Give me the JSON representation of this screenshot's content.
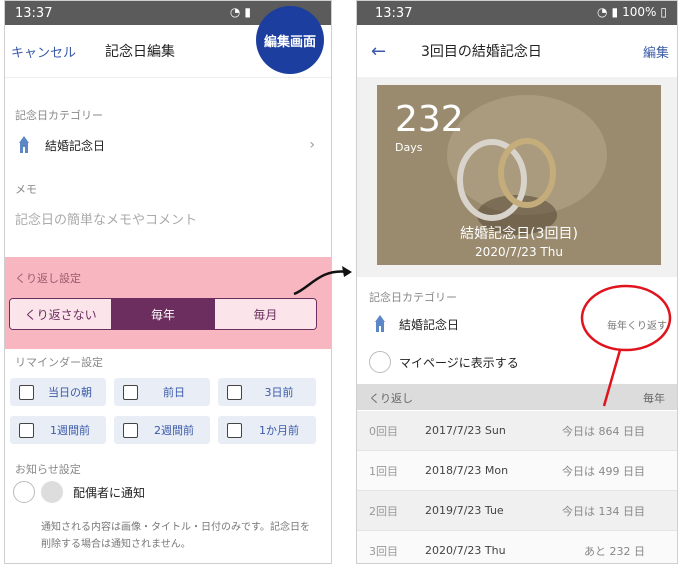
{
  "left": {
    "status_time": "13:37",
    "badge": "編集画面",
    "nav": {
      "cancel": "キャンセル",
      "title": "記念日編集"
    },
    "category": {
      "label": "記念日カテゴリー",
      "value": "結婚記念日"
    },
    "memo": {
      "label": "メモ",
      "placeholder": "記念日の簡単なメモやコメント"
    },
    "repeat": {
      "label": "くり返し設定",
      "options": [
        "くり返さない",
        "毎年",
        "毎月"
      ],
      "selected": "毎年"
    },
    "reminder": {
      "label": "リマインダー設定",
      "options": [
        "当日の朝",
        "前日",
        "3日前",
        "1週間前",
        "2週間前",
        "1か月前"
      ]
    },
    "notify": {
      "label": "お知らせ設定",
      "spouse": "配偶者に通知",
      "note": "通知される内容は画像・タイトル・日付のみです。記念日を削除する場合は通知されません。"
    }
  },
  "right": {
    "status_time": "13:37",
    "battery": "100%",
    "nav": {
      "title": "3回目の結婚記念日",
      "edit": "編集"
    },
    "hero": {
      "days": "232",
      "days_unit": "Days",
      "caption": "結婚記念日(3回目)",
      "date": "2020/7/23 Thu"
    },
    "category": {
      "label": "記念日カテゴリー",
      "value": "結婚記念日",
      "repeat": "毎年くり返す"
    },
    "mypage": "マイページに表示する",
    "table": {
      "header_left": "くり返し",
      "header_right": "毎年",
      "rows": [
        {
          "n": "0回目",
          "date": "2017/7/23 Sun",
          "info": "今日は 864 日目"
        },
        {
          "n": "1回目",
          "date": "2018/7/23 Mon",
          "info": "今日は 499 日目"
        },
        {
          "n": "2回目",
          "date": "2019/7/23 Tue",
          "info": "今日は 134 日目"
        },
        {
          "n": "3回目",
          "date": "2020/7/23 Thu",
          "info": "あと 232 日"
        }
      ]
    }
  },
  "colors": {
    "accent": "#3b5aa8",
    "repeat_bg": "#f7b6c0",
    "selected": "#6b2e5e",
    "badge": "#1c3e9e",
    "annotation": "#e0141e"
  }
}
